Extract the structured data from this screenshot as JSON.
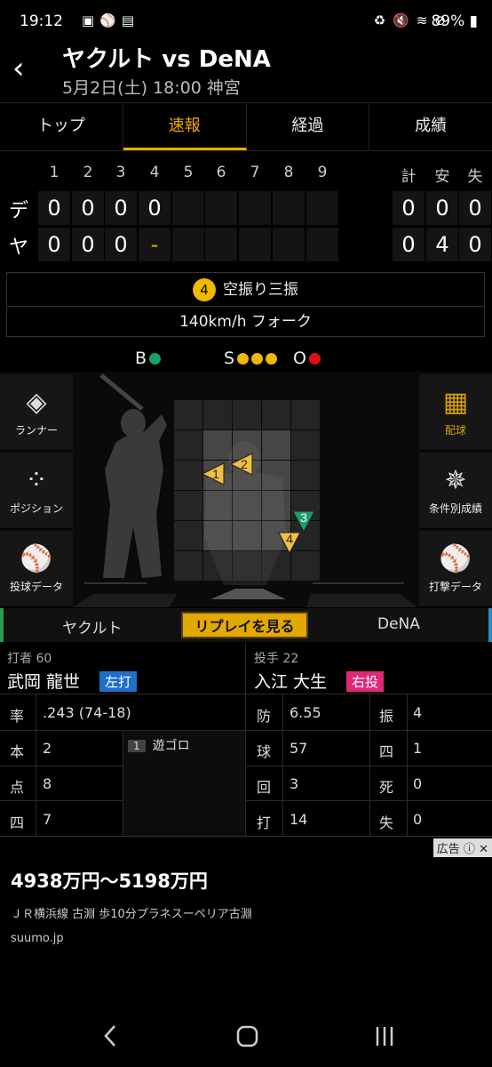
{
  "status": {
    "time": "19:12",
    "battery": "89%"
  },
  "header": {
    "title": "ヤクルト vs DeNA",
    "subtitle": "5月2日(土) 18:00 神宮"
  },
  "tabs": [
    "トップ",
    "速報",
    "経過",
    "成績"
  ],
  "scoreboard": {
    "innings": [
      "1",
      "2",
      "3",
      "4",
      "5",
      "6",
      "7",
      "8",
      "9"
    ],
    "totals_headers": [
      "計",
      "安",
      "失"
    ],
    "rows": [
      {
        "team": "デ",
        "scores": [
          "0",
          "0",
          "0",
          "0",
          "",
          "",
          "",
          "",
          ""
        ],
        "totals": [
          "0",
          "0",
          "0"
        ]
      },
      {
        "team": "ヤ",
        "scores": [
          "0",
          "0",
          "0",
          "-",
          "",
          "",
          "",
          "",
          ""
        ],
        "totals": [
          "0",
          "4",
          "0"
        ]
      }
    ]
  },
  "play": {
    "pitch_no": "4",
    "result": "空振り三振",
    "detail": "140km/h フォーク"
  },
  "count": {
    "b_label": "B",
    "s_label": "S",
    "o_label": "O",
    "balls": 1,
    "strikes": 3,
    "outs": 1,
    "ball_color": "#1aa06a",
    "strike_color": "#f0b800",
    "out_color": "#e01010"
  },
  "side_left": [
    {
      "label": "ランナー",
      "icon": "diamond-icon"
    },
    {
      "label": "ポジション",
      "icon": "field-positions-icon"
    },
    {
      "label": "投球データ",
      "icon": "pitcher-icon"
    }
  ],
  "side_right": [
    {
      "label": "配球",
      "icon": "pitch-grid-icon"
    },
    {
      "label": "条件別成績",
      "icon": "radar-chart-icon"
    },
    {
      "label": "打撃データ",
      "icon": "batter-icon"
    }
  ],
  "pitches": [
    {
      "no": "1",
      "color": "#f0c040",
      "dir": "left"
    },
    {
      "no": "2",
      "color": "#f0c040",
      "dir": "left"
    },
    {
      "no": "3",
      "color": "#1aa06a",
      "dir": "down"
    },
    {
      "no": "4",
      "color": "#f0c040",
      "dir": "down"
    }
  ],
  "teambar": {
    "left": "ヤクルト",
    "replay": "リプレイを見る",
    "right": "DeNA"
  },
  "batter": {
    "role": "打者 60",
    "name": "武岡 龍世",
    "hand": "左打",
    "hand_color": "#1e6fc8",
    "stats": [
      {
        "k": "率",
        "v": ".243 (74-18)"
      },
      {
        "k": "本",
        "v": "2"
      },
      {
        "k": "点",
        "v": "8"
      },
      {
        "k": "四",
        "v": "7"
      }
    ],
    "atbat": {
      "no": "1",
      "result": "遊ゴロ"
    }
  },
  "pitcher": {
    "role": "投手 22",
    "name": "入江 大生",
    "hand": "右投",
    "hand_color": "#e0287a",
    "stats_left": [
      {
        "k": "防",
        "v": "6.55"
      },
      {
        "k": "球",
        "v": "57"
      },
      {
        "k": "回",
        "v": "3"
      },
      {
        "k": "打",
        "v": "14"
      }
    ],
    "stats_right": [
      {
        "k": "振",
        "v": "4"
      },
      {
        "k": "四",
        "v": "1"
      },
      {
        "k": "死",
        "v": "0"
      },
      {
        "k": "失",
        "v": "0"
      }
    ]
  },
  "ad": {
    "tag": "広告",
    "price": "4938万円〜5198万円",
    "line": "ＪＲ横浜線 古淵 歩10分プラネスーペリア古淵",
    "domain": "suumo.jp"
  }
}
